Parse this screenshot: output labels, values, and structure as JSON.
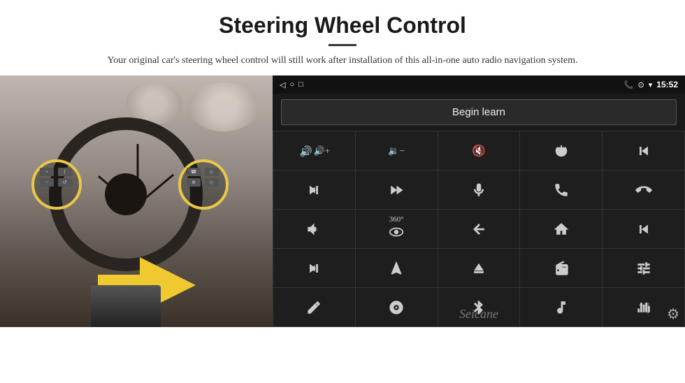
{
  "header": {
    "title": "Steering Wheel Control",
    "subtitle": "Your original car's steering wheel control will still work after installation of this all-in-one auto radio navigation system."
  },
  "display": {
    "status_bar": {
      "nav_back": "◁",
      "nav_home": "○",
      "nav_square": "□",
      "signal_icon": "▪▪",
      "phone_icon": "📞",
      "location_icon": "⊙",
      "wifi_icon": "▾",
      "time": "15:52"
    },
    "begin_learn_label": "Begin learn",
    "watermark": "Seicane",
    "buttons": [
      {
        "id": "vol-up",
        "icon": "vol-up"
      },
      {
        "id": "vol-down",
        "icon": "vol-down"
      },
      {
        "id": "mute",
        "icon": "mute"
      },
      {
        "id": "power",
        "icon": "power"
      },
      {
        "id": "prev-track-phone",
        "icon": "prev-track-phone"
      },
      {
        "id": "next-track",
        "icon": "next-track"
      },
      {
        "id": "fast-forward",
        "icon": "fast-forward"
      },
      {
        "id": "mic",
        "icon": "mic"
      },
      {
        "id": "phone",
        "icon": "phone"
      },
      {
        "id": "hang-up",
        "icon": "hang-up"
      },
      {
        "id": "horn",
        "icon": "horn"
      },
      {
        "id": "360-view",
        "icon": "360-view"
      },
      {
        "id": "back",
        "icon": "back"
      },
      {
        "id": "home",
        "icon": "home"
      },
      {
        "id": "skip-back",
        "icon": "skip-back"
      },
      {
        "id": "skip-forward",
        "icon": "skip-forward"
      },
      {
        "id": "nav",
        "icon": "nav"
      },
      {
        "id": "eject",
        "icon": "eject"
      },
      {
        "id": "radio",
        "icon": "radio"
      },
      {
        "id": "settings-sliders",
        "icon": "settings-sliders"
      },
      {
        "id": "pen",
        "icon": "pen"
      },
      {
        "id": "cd",
        "icon": "cd"
      },
      {
        "id": "bluetooth",
        "icon": "bluetooth"
      },
      {
        "id": "music",
        "icon": "music"
      },
      {
        "id": "eq",
        "icon": "eq"
      }
    ]
  }
}
